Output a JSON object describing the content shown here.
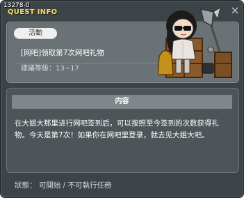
{
  "window": {
    "quest_id": "13278-0",
    "title": "QUEST INFO"
  },
  "quest": {
    "category_tag": "活動",
    "name": "[网吧]领取第7次网吧礼物",
    "level_label": "建議等級：13~17"
  },
  "content": {
    "header": "内容",
    "body": "在大姐大那里进行网吧签到后，可以按照至今签到的次数获得礼物。今天是第7次！如果你在网吧里登录，就去见大姐大吧。"
  },
  "status": {
    "text": "狀態： 可開始 / 不可執行任務"
  },
  "npc": {
    "icon": "npc-portrait-icon"
  },
  "colors": {
    "window_bg": "#3d4448",
    "title": "#f3e060",
    "card_bg": "#6a7276",
    "header_bg": "#7f878b"
  }
}
